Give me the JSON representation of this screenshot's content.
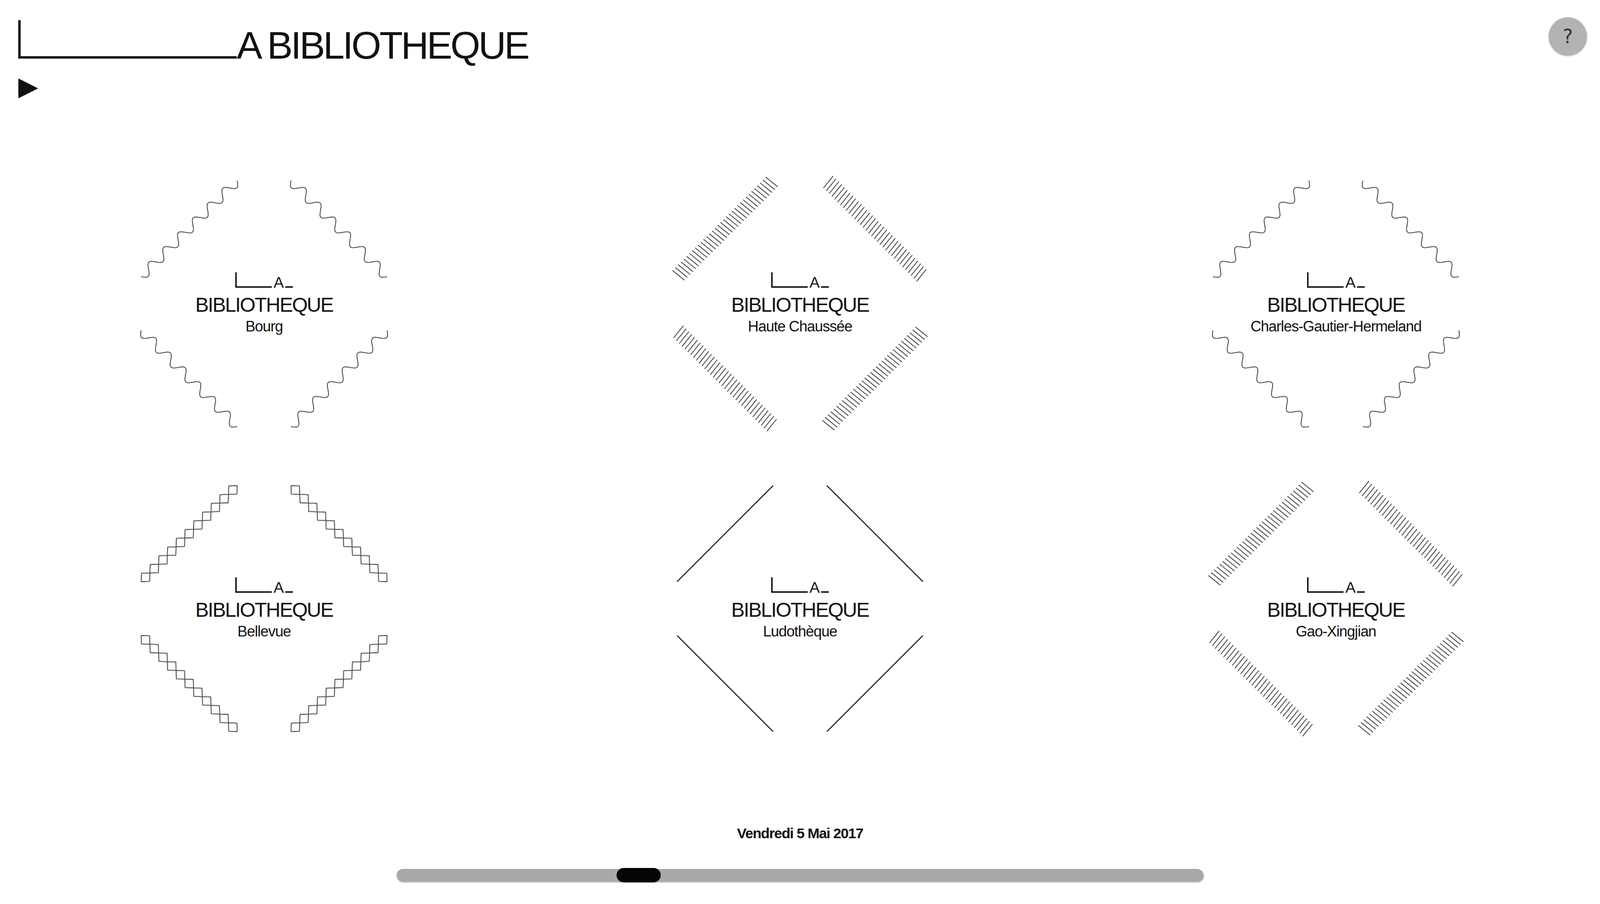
{
  "header": {
    "logo_text": "A BIBLIOTHEQUE",
    "play_icon": "▶",
    "help_icon": "?"
  },
  "libraries": [
    {
      "logo_letter": "A",
      "title": "BIBLIOTHEQUE",
      "name": "Bourg",
      "kind": "wave"
    },
    {
      "logo_letter": "A",
      "title": "BIBLIOTHEQUE",
      "name": "Haute Chaussée",
      "kind": "hatch"
    },
    {
      "logo_letter": "A",
      "title": "BIBLIOTHEQUE",
      "name": "Charles-Gautier-Hermeland",
      "kind": "wave"
    },
    {
      "logo_letter": "A",
      "title": "BIBLIOTHEQUE",
      "name": "Bellevue",
      "kind": "zigzag"
    },
    {
      "logo_letter": "A",
      "title": "BIBLIOTHEQUE",
      "name": "Ludothèque",
      "kind": "line"
    },
    {
      "logo_letter": "A",
      "title": "BIBLIOTHEQUE",
      "name": "Gao-Xingjian",
      "kind": "hatch"
    }
  ],
  "date": "Vendredi 5 Mai 2017",
  "timeline": {
    "level": 0.3
  }
}
